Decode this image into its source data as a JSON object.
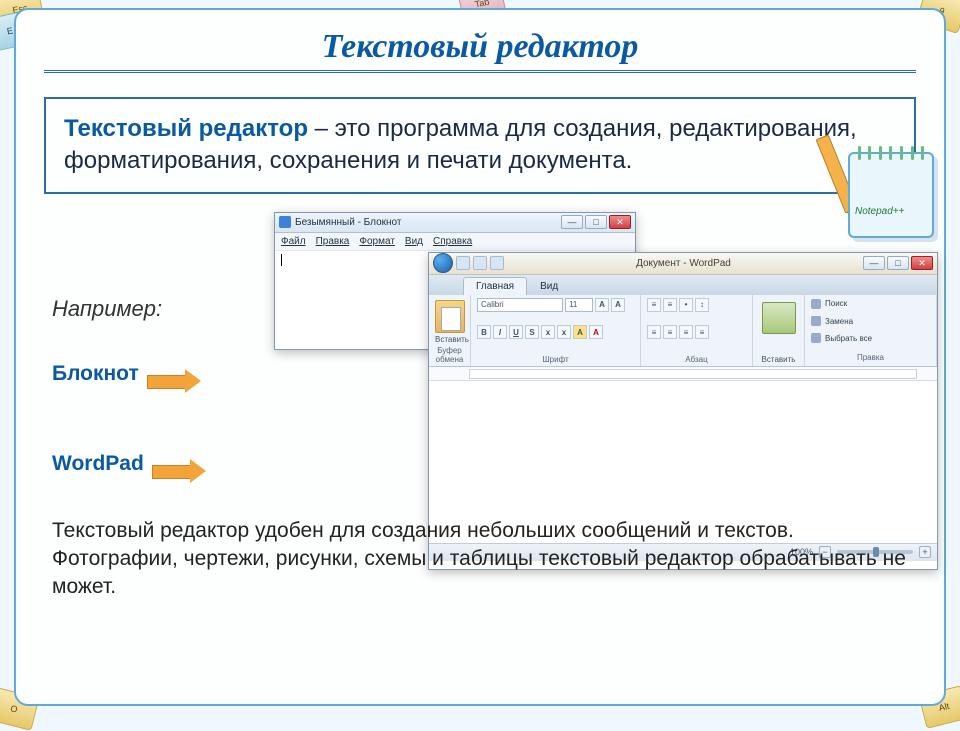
{
  "slide": {
    "title": "Текстовый редактор",
    "definition_term": "Текстовый редактор",
    "definition_rest": " – это программа для создания, редактирования, форматирования, сохранения и печати документа.",
    "example_label": "Например:",
    "app1": "Блокнот",
    "app2": "WordPad",
    "footer": "Текстовый редактор удобен для создания небольших сообщений и текстов. Фотографии, чертежи, рисунки, схемы и таблицы текстовый редактор обрабатывать не может.",
    "notepad_logo": "Notepad++"
  },
  "notepad": {
    "title": "Безымянный - Блокнот",
    "menu": [
      "Файл",
      "Правка",
      "Формат",
      "Вид",
      "Справка"
    ]
  },
  "wordpad": {
    "doc_title": "Документ - WordPad",
    "tabs": {
      "home": "Главная",
      "view": "Вид"
    },
    "groups": {
      "clipboard": "Буфер обмена",
      "font": "Шрифт",
      "paragraph": "Абзац",
      "insert": "",
      "editing": "Правка"
    },
    "paste": "Вставить",
    "font_name": "Calibri",
    "font_size": "11",
    "insert_label": "Вставить",
    "edit": {
      "find": "Поиск",
      "replace": "Замена",
      "select": "Выбрать все"
    },
    "zoom": "100%",
    "minus": "−",
    "plus": "+"
  },
  "keys": {
    "tl1": "Esc",
    "tl2": "E",
    "tc": "Tab",
    "tr1": "9",
    "bl": "O",
    "br": "Alt"
  },
  "winbtns": {
    "min": "—",
    "max": "□",
    "close": "✕"
  }
}
